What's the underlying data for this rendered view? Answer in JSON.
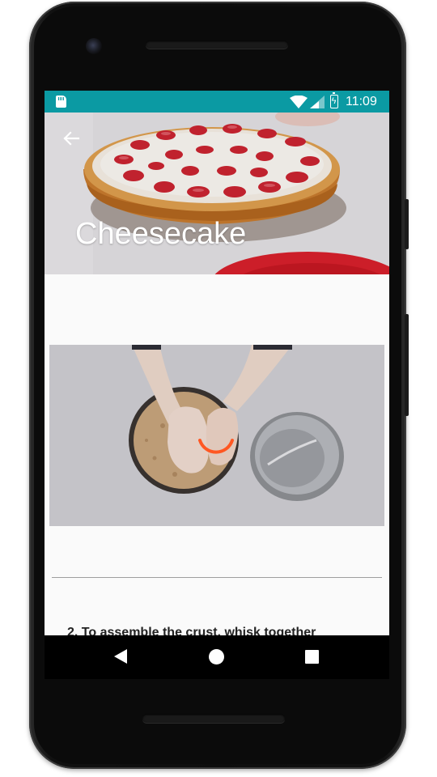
{
  "status_bar": {
    "time": "11:09",
    "icons": [
      "sd-card-icon",
      "wifi-icon",
      "signal-icon",
      "battery-charging-icon"
    ],
    "color": "#0b9aa3"
  },
  "header": {
    "back_icon": "arrow-left-icon",
    "title": "Cheesecake"
  },
  "content": {
    "video": {
      "state": "loading",
      "spinner_color": "#ff5722"
    },
    "step_text": "2. To assemble the crust, whisk together"
  },
  "nav_bar": {
    "buttons": [
      "back-triangle-icon",
      "home-circle-icon",
      "recents-square-icon"
    ]
  }
}
